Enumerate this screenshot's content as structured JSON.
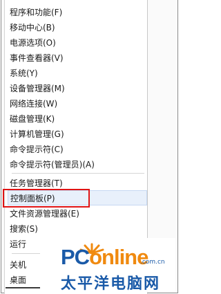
{
  "menu": {
    "items": [
      {
        "label": "程序和功能(F)"
      },
      {
        "label": "移动中心(B)"
      },
      {
        "label": "电源选项(O)"
      },
      {
        "label": "事件查看器(V)"
      },
      {
        "label": "系统(Y)"
      },
      {
        "label": "设备管理器(M)"
      },
      {
        "label": "网络连接(W)"
      },
      {
        "label": "磁盘管理(K)"
      },
      {
        "label": "计算机管理(G)"
      },
      {
        "label": "命令提示符(C)"
      },
      {
        "label": "命令提示符(管理员)(A)"
      },
      {
        "label": "任务管理器(T)"
      },
      {
        "label": "控制面板(P)"
      },
      {
        "label": "文件资源管理器(E)"
      },
      {
        "label": "搜索(S)"
      },
      {
        "label": "运行"
      },
      {
        "label": "关机"
      },
      {
        "label": "桌面"
      }
    ]
  },
  "watermark": {
    "logo_part1": "PC",
    "logo_part2": "online",
    "domain": ".com.cn",
    "subtitle": "太平洋电脑网"
  },
  "colors": {
    "highlight": "#e8f0fb",
    "red_box": "#e01414",
    "brand_blue": "#1a5aa8",
    "brand_orange": "#f08a10"
  }
}
